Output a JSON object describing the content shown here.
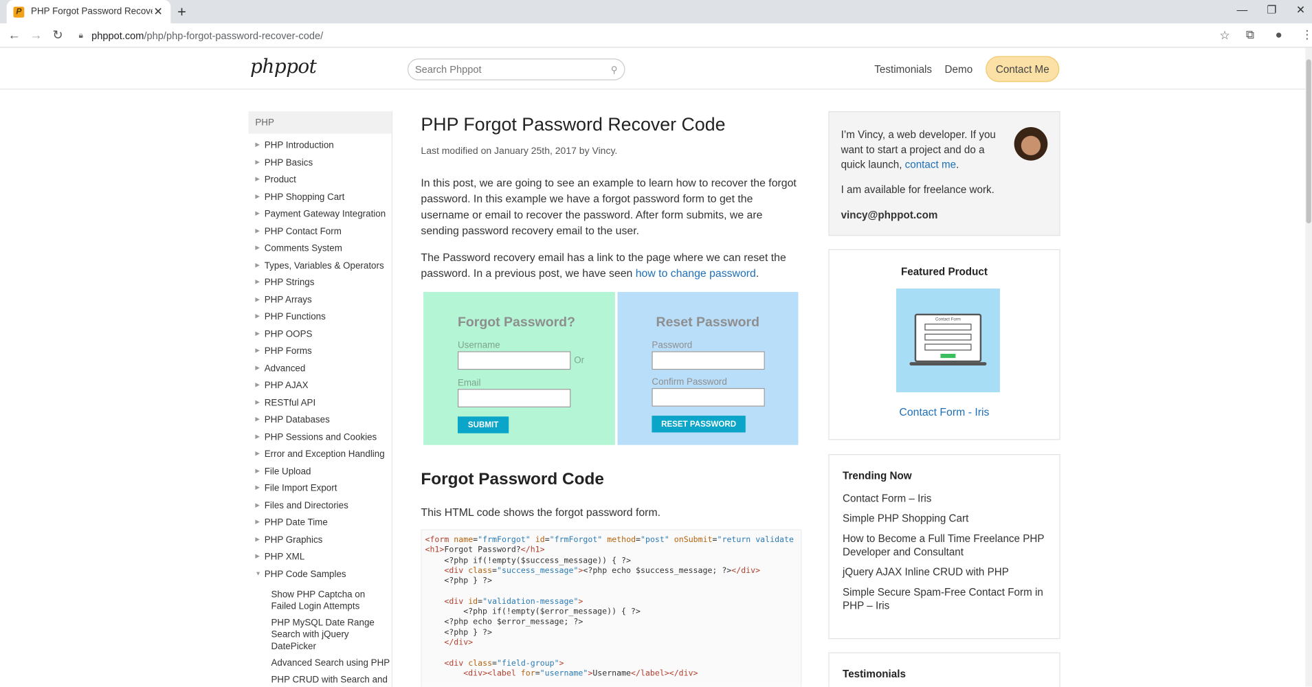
{
  "browser": {
    "tab_title": "PHP Forgot Password Recover Co",
    "favicon_letter": "P",
    "url_host": "phppot.com",
    "url_path": "/php/php-forgot-password-recover-code/"
  },
  "site": {
    "logo": "phppot",
    "search_placeholder": "Search Phppot",
    "nav": {
      "testimonials": "Testimonials",
      "demo": "Demo",
      "contact": "Contact Me"
    }
  },
  "sidebar": {
    "category": "PHP",
    "items": [
      "PHP Introduction",
      "PHP Basics",
      "Product",
      "PHP Shopping Cart",
      "Payment Gateway Integration",
      "PHP Contact Form",
      "Comments System",
      "Types, Variables & Operators",
      "PHP Strings",
      "PHP Arrays",
      "PHP Functions",
      "PHP OOPS",
      "PHP Forms",
      "Advanced",
      "PHP AJAX",
      "RESTful API",
      "PHP Databases",
      "PHP Sessions and Cookies",
      "Error and Exception Handling",
      "File Upload",
      "File Import Export",
      "Files and Directories",
      "PHP Date Time",
      "PHP Graphics",
      "PHP XML",
      "PHP Code Samples"
    ],
    "subitems": [
      "Show PHP Captcha on Failed Login Attempts",
      "PHP MySQL Date Range Search with jQuery DatePicker",
      "Advanced Search using PHP",
      "PHP CRUD with Search and Pagination"
    ]
  },
  "article": {
    "title": "PHP Forgot Password Recover Code",
    "meta": "Last modified on January 25th, 2017 by Vincy.",
    "p1": "In this post, we are going to see an example to learn how to recover the forgot password. In this example we have a forgot password form to get the username or email to recover the password. After form submits, we are sending password recovery email to the user.",
    "p2_start": "The Password recovery email has a link to the page where we can reset the password. In a previous post, we have seen ",
    "p2_link": "how to change password",
    "p2_end": ".",
    "demo": {
      "forgot_title": "Forgot Password?",
      "username_label": "Username",
      "or_label": "Or",
      "email_label": "Email",
      "submit_label": "SUBMIT",
      "reset_title": "Reset Password",
      "password_label": "Password",
      "confirm_label": "Confirm Password",
      "reset_label": "RESET PASSWORD"
    },
    "h2": "Forgot Password Code",
    "p3": "This HTML code shows the forgot password form."
  },
  "about": {
    "bio_start": "I’m Vincy, a web developer. If you want to start a project and do a quick launch, ",
    "bio_link": "contact me",
    "bio_end": ".",
    "availability": "I am available for freelance work.",
    "email": "vincy@phppot.com"
  },
  "featured": {
    "title": "Featured Product",
    "image_caption": "Contact Form",
    "product_link": "Contact Form - Iris"
  },
  "trending": {
    "title": "Trending Now",
    "items": [
      "Contact Form – Iris",
      "Simple PHP Shopping Cart",
      "How to Become a Full Time Freelance PHP Developer and Consultant",
      "jQuery AJAX Inline CRUD with PHP",
      "Simple Secure Spam-Free Contact Form in PHP – Iris"
    ]
  },
  "testimonials_title": "Testimonials"
}
